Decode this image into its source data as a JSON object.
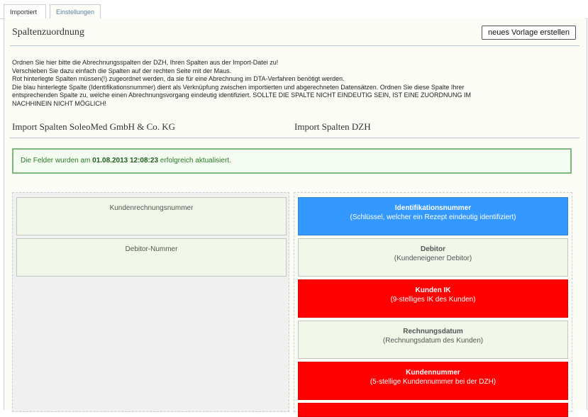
{
  "tabs": [
    {
      "label": "Importiert"
    },
    {
      "label": "Einstellungen"
    }
  ],
  "section": {
    "title": "Spaltenzuordnung",
    "new_template_button": "neues Vorlage erstellen"
  },
  "intro_lines": [
    "Ordnen Sie hier bitte die Abrechnungsspalten der DZH, Ihren Spalten aus der Import-Datei zu!",
    "Verschieben Sie dazu einfach die Spalten auf der rechten Seite mit der Maus.",
    "Rot hinterlegte Spalten müssen(!) zugeordnet werden, da sie für eine Abrechnung im DTA-Verfahren benötigt werden.",
    "Die blau hinterlegte Spalte (Identifikationsnummer) dient als Verknüpfung zwischen importierten und abgerechneten Datensätzen. Ordnen Sie diese Spalte Ihrer",
    "entsprechenden Spalte zu, welche einen Abrechnungsvorgang eindeutig identifiziert. SOLLTE DIE SPALTE NICHT EINDEUTIG SEIN, IST EINE ZUORDNUNG IM",
    "NACHHINEIN NICHT MÖGLICH!"
  ],
  "headings": {
    "left": "Import Spalten SoleoMed GmbH & Co. KG",
    "right": "Import Spalten DZH"
  },
  "notice": {
    "prefix": "Die Felder wurden am ",
    "datetime": "01.08.2013 12:08:23",
    "suffix": " erfolgreich aktualisiert."
  },
  "left_columns": [
    {
      "label": "Kundenrechnungsnummer"
    },
    {
      "label": "Debitor-Nummer"
    }
  ],
  "right_columns": [
    {
      "title": "Identifikationsnummer",
      "subtitle": "(Schlüssel, welcher ein Rezept eindeutig identifiziert)",
      "status": "blue"
    },
    {
      "title": "Debitor",
      "subtitle": "(Kundeneigener Debitor)",
      "status": "plain"
    },
    {
      "title": "Kunden IK",
      "subtitle": "(9-stelliges IK des Kunden)",
      "status": "red"
    },
    {
      "title": "Rechnungsdatum",
      "subtitle": "(Rechnungsdatum des Kunden)",
      "status": "plain"
    },
    {
      "title": "Kundennummer",
      "subtitle": "(5-stellige Kundennummer bei der DZH)",
      "status": "red"
    }
  ],
  "colors": {
    "blue": "#3399ff",
    "red": "#ff0000",
    "plain": "#f1f8e9",
    "success_border": "#7fb87f"
  }
}
